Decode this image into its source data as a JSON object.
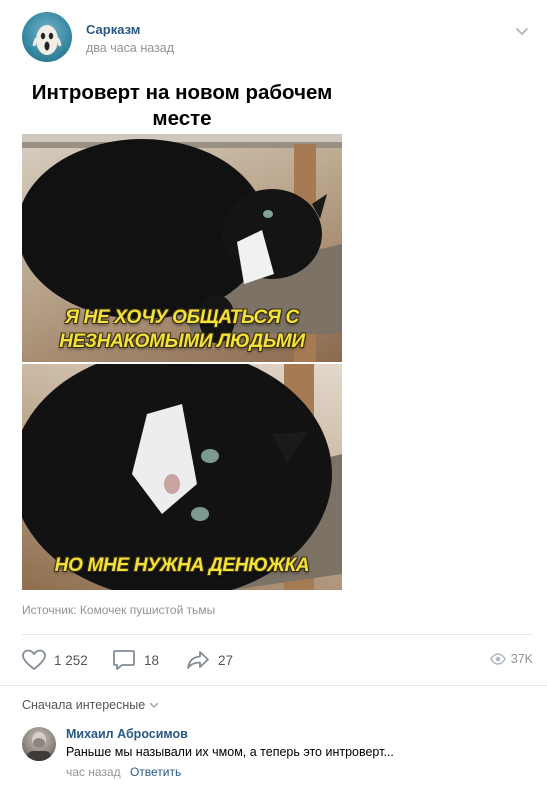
{
  "post": {
    "author": "Сарказм",
    "time": "два часа назад",
    "meme_title": "Интроверт на новом рабочем месте",
    "caption_top": "Я НЕ ХОЧУ ОБЩАТЬСЯ С НЕЗНАКОМЫМИ ЛЮДЬМИ",
    "caption_bottom": "НО МНЕ НУЖНА ДЕНЮЖКА",
    "source": "Источник: Комочек пушистой тьмы"
  },
  "actions": {
    "likes": "1 252",
    "comments": "18",
    "shares": "27",
    "views": "37K"
  },
  "comments_section": {
    "sort_label": "Сначала интересные",
    "items": [
      {
        "author": "Михаил Абросимов",
        "text": "Раньше мы называли их чмом, а теперь это интроверт...",
        "time": "час назад",
        "reply_label": "Ответить"
      }
    ]
  },
  "colors": {
    "link_blue": "#2a5885",
    "muted_gray": "#939393",
    "caption_yellow": "#f3e23a"
  },
  "icons": [
    "chevron-down-icon",
    "heart-icon",
    "comment-icon",
    "share-icon",
    "eye-icon"
  ]
}
